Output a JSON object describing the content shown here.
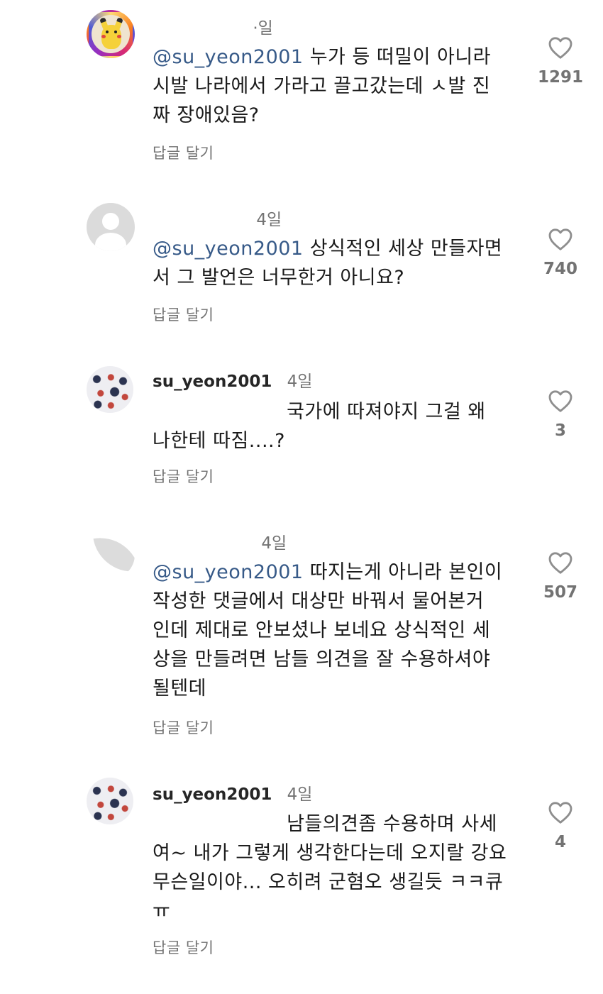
{
  "comments": [
    {
      "time": "·일",
      "mention": "@su_yeon2001",
      "text": " 누가 등 떠밀이 아니라 시발 나라에서 가라고 끌고갔는데 ㅅ발 진짜 장애있음?",
      "reply_label": "답글 달기",
      "likes": "1291",
      "avatar_icon": "pikachu-avatar-icon"
    },
    {
      "time": "4일",
      "mention": "@su_yeon2001",
      "text": " 상식적인 세상 만들자면서 그 발언은 너무한거 아니요?",
      "reply_label": "답글 달기",
      "likes": "740",
      "avatar_icon": "default-avatar-icon"
    },
    {
      "username": "su_yeon2001",
      "time": "4일",
      "text": " 국가에 따져야지 그걸 왜 나한테 따짐....?",
      "reply_label": "답글 달기",
      "likes": "3",
      "avatar_icon": "pattern-avatar-icon"
    },
    {
      "time": "4일",
      "mention": "@su_yeon2001",
      "text": " 따지는게 아니라 본인이 작성한 댓글에서 대상만 바꿔서 물어본거 인데 제대로 안보셨나 보네요 상식적인 세상을 만들려면 남들 의견을 잘 수용하셔야 될텐데",
      "reply_label": "답글 달기",
      "likes": "507",
      "avatar_icon": "partial-avatar-icon"
    },
    {
      "username": "su_yeon2001",
      "time": "4일",
      "text": " 남들의견좀 수용하며 사세여~ 내가 그렇게 생각한다는데 오지랄 강요 무슨일이야... 오히려 군혐오 생길듯 ㅋㅋ큐ㅠ",
      "reply_label": "답글 달기",
      "likes": "4",
      "avatar_icon": "pattern-avatar-icon"
    }
  ]
}
